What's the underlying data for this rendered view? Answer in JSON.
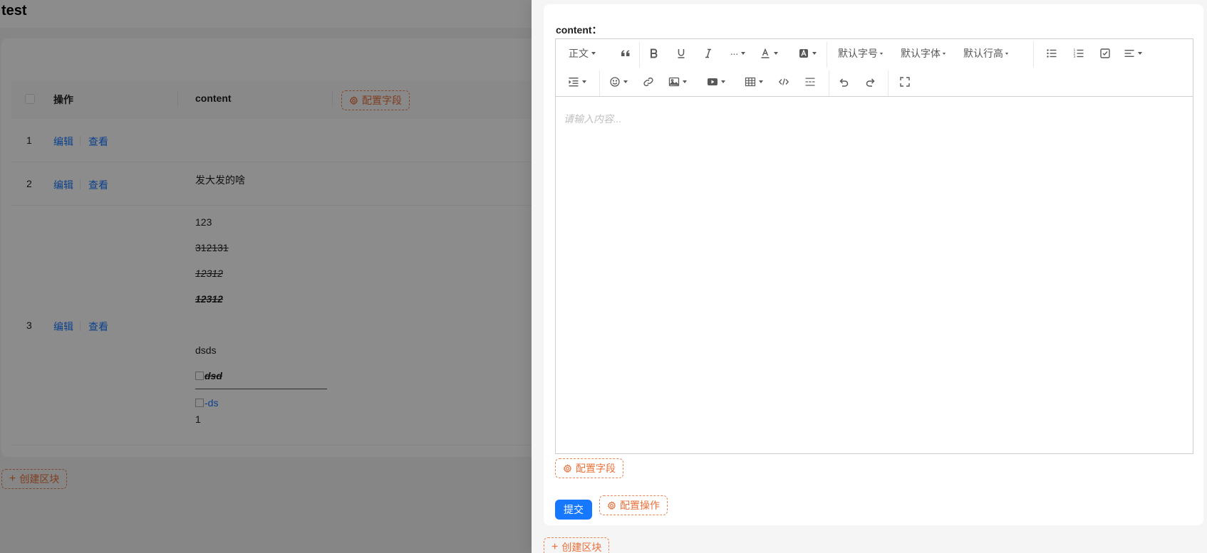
{
  "page": {
    "title": "test",
    "create_block_label": "创建区块"
  },
  "table": {
    "columns": {
      "actions": "操作",
      "content": "content",
      "configure_fields": "配置字段"
    },
    "action_edit": "编辑",
    "action_view": "查看",
    "rows": [
      {
        "index": "1",
        "content": ""
      },
      {
        "index": "2",
        "content": "发大发的啥"
      },
      {
        "index": "3",
        "content_lines": [
          "123",
          "312131",
          "12312",
          "12312",
          "dsds",
          "dsd",
          "-ds",
          "1"
        ]
      }
    ]
  },
  "drawer": {
    "field_label": "content：",
    "toolbar": {
      "paragraph": "正文",
      "font_size": "默认字号",
      "font_family": "默认字体",
      "line_height": "默认行高",
      "icons_row1": [
        "quote-icon",
        "bold-icon",
        "underline-icon",
        "italic-icon",
        "more-icon",
        "font-color-icon",
        "background-color-icon",
        "bulleted-list-icon",
        "numbered-list-icon",
        "todo-icon",
        "align-icon"
      ],
      "icons_row2": [
        "indent-icon",
        "emoji-icon",
        "link-icon",
        "image-icon",
        "video-icon",
        "table-icon",
        "code-icon",
        "divider-icon",
        "undo-icon",
        "redo-icon",
        "fullscreen-icon"
      ]
    },
    "editor_placeholder": "请输入内容...",
    "configure_fields": "配置字段",
    "submit": "提交",
    "configure_actions": "配置操作",
    "create_block": "创建区块"
  },
  "colors": {
    "primary": "#1677ff",
    "designer_orange": "#e8703a",
    "overlay": "rgba(0,0,0,0.45)"
  }
}
